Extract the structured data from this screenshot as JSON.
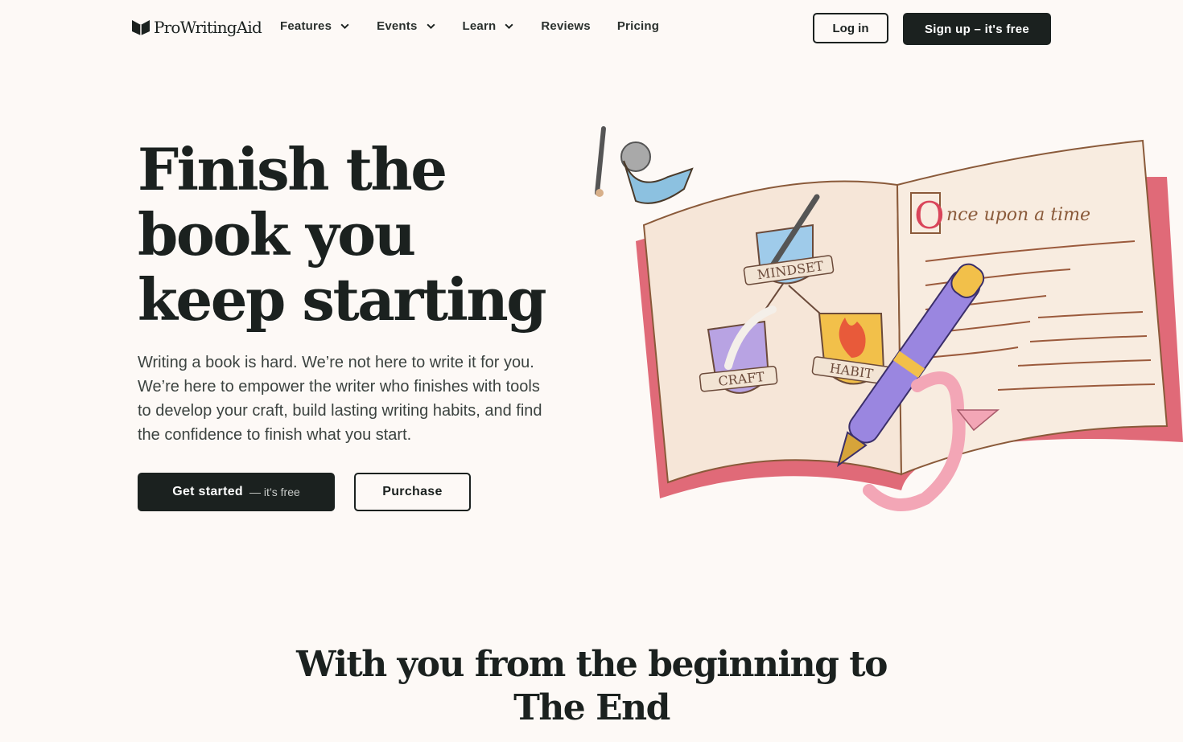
{
  "brand": {
    "name": "ProWritingAid"
  },
  "nav": {
    "items": [
      {
        "label": "Features",
        "has_dropdown": true
      },
      {
        "label": "Events",
        "has_dropdown": true
      },
      {
        "label": "Learn",
        "has_dropdown": true
      },
      {
        "label": "Reviews",
        "has_dropdown": false
      },
      {
        "label": "Pricing",
        "has_dropdown": false
      }
    ],
    "login_label": "Log in",
    "signup_label": "Sign up – it's free"
  },
  "hero": {
    "title": "Finish the book you keep starting",
    "subtitle": "Writing a book is hard. We’re not here to write it for you. We’re here to empower the writer who finishes with tools to develop your craft, build lasting writing habits, and find the confidence to finish what you start.",
    "cta_primary": "Get started",
    "cta_primary_sub": "— it’s free",
    "cta_secondary": "Purchase"
  },
  "illustration": {
    "book_text": "nce upon a time",
    "drop_cap": "O",
    "badges": [
      "MINDSET",
      "CRAFT",
      "HABIT"
    ]
  },
  "section": {
    "title": "With you from the beginning to The End"
  },
  "colors": {
    "background": "#fdf9f6",
    "primary": "#1b211f",
    "book_cover": "#e06a78",
    "pen": "#9a86e0"
  }
}
